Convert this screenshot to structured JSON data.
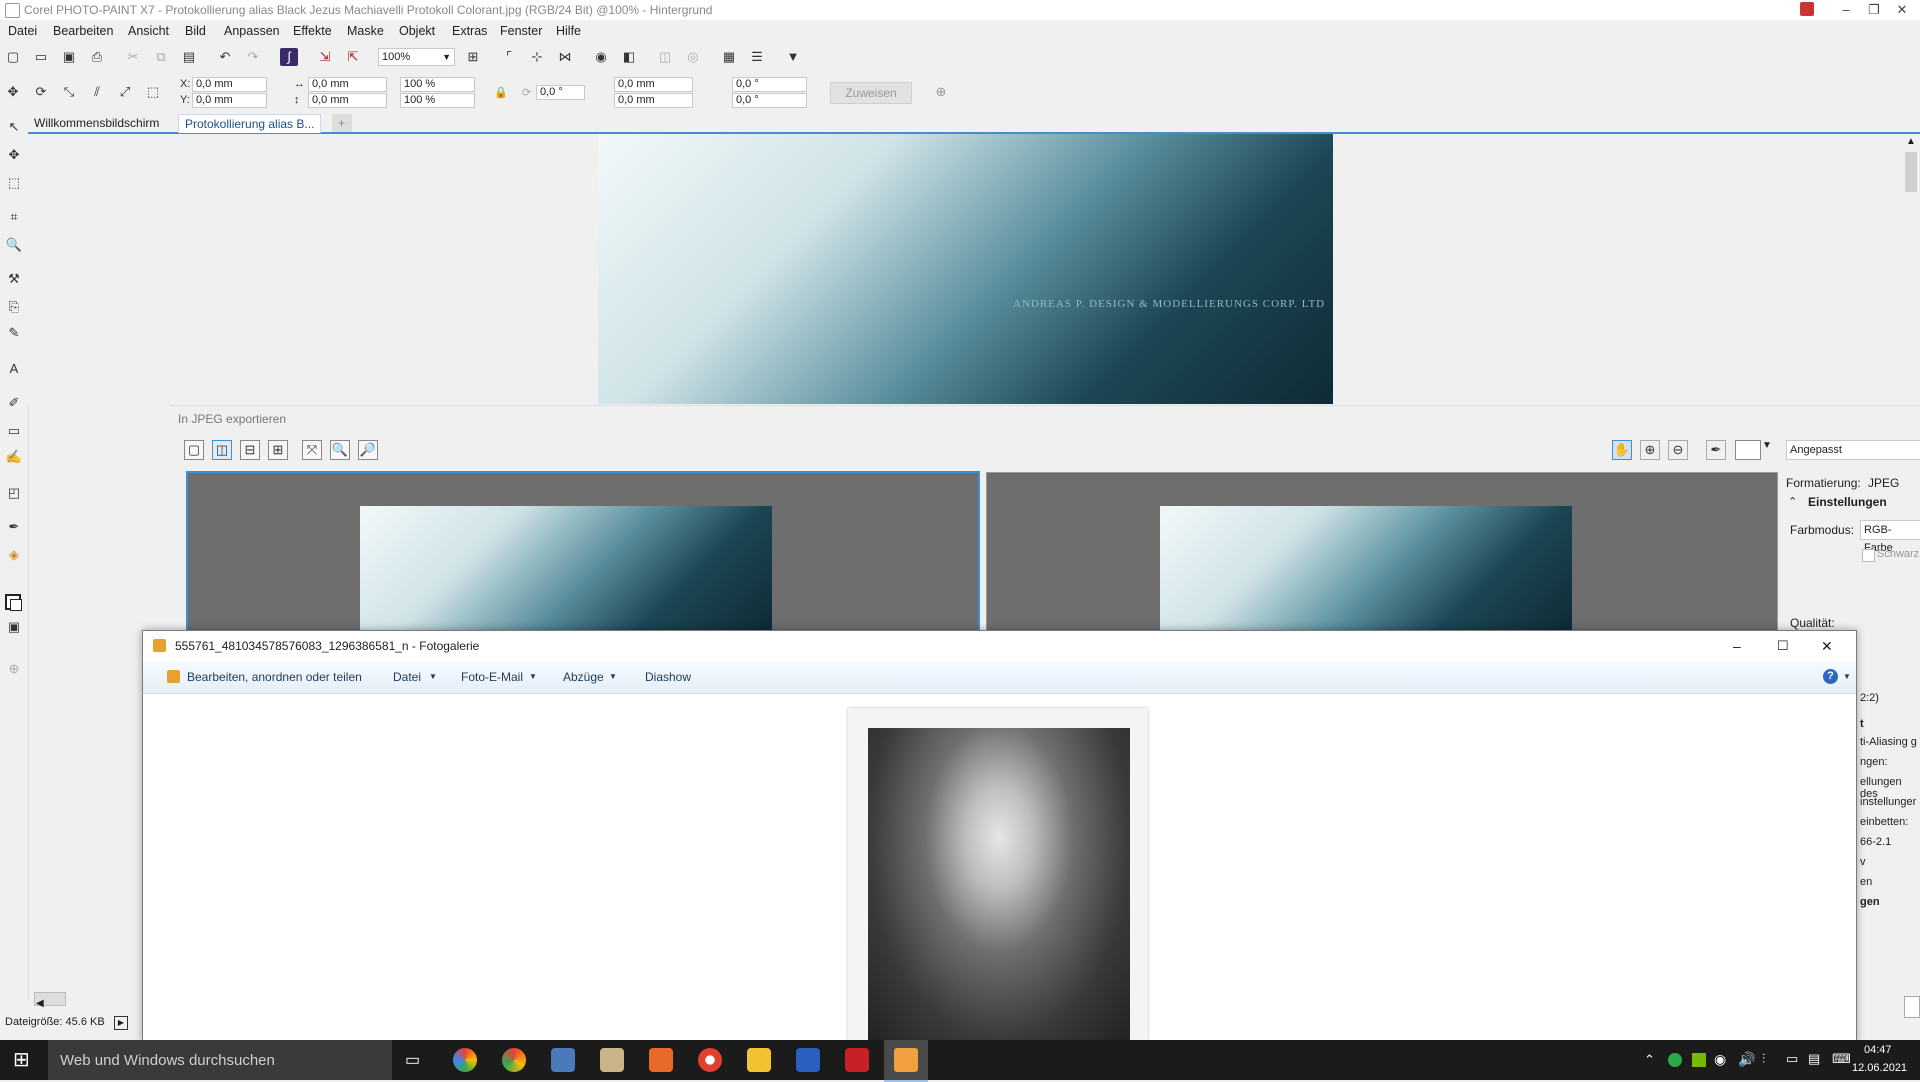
{
  "app": {
    "title": "Corel PHOTO-PAINT X7 - Protokollierung alias Black Jezus Machiavelli Protokoll Colorant.jpg (RGB/24 Bit) @100% - Hintergrund"
  },
  "menu": [
    "Datei",
    "Bearbeiten",
    "Ansicht",
    "Bild",
    "Anpassen",
    "Effekte",
    "Maske",
    "Objekt",
    "Extras",
    "Fenster",
    "Hilfe"
  ],
  "toolbar": {
    "zoom_value": "100%",
    "assign_button": "Zuweisen"
  },
  "property_bar": {
    "x_label": "X:",
    "x_value": "0,0 mm",
    "y_label": "Y:",
    "y_value": "0,0 mm",
    "w_value": "0,0 mm",
    "h_value": "0,0 mm",
    "scale_x": "100 %",
    "scale_y": "100 %",
    "rotation": "0,0 °",
    "center_x": "0,0 mm",
    "center_y": "0,0 mm",
    "skew_h": "0,0 °",
    "skew_v": "0,0 °"
  },
  "tabs": [
    {
      "label": "Willkommensbildschirm"
    },
    {
      "label": "Protokollierung alias B..."
    }
  ],
  "canvas_watermark": "ANDREAS P. DESIGN & MODELLIERUNGS CORP. LTD",
  "export_dialog": {
    "title": "In JPEG exportieren",
    "zoom_preset": "Angepasst",
    "format_label": "Formatierung:",
    "format_value": "JPEG",
    "settings_header": "Einstellungen",
    "color_mode_label": "Farbmodus:",
    "color_mode_value": "RGB-Farbe",
    "checkbox_label": "Schwarz",
    "quality_label": "Qualität:",
    "side_fragments": [
      "2:2)",
      "t",
      "ti-Aliasing g",
      "ngen:",
      "ellungen des",
      "instellunger",
      "einbetten:",
      "66-2.1",
      "v",
      "en",
      "gen"
    ]
  },
  "gallery": {
    "title": "555761_481034578576083_1296386581_n - Fotogalerie",
    "menu": [
      "Bearbeiten, anordnen oder teilen",
      "Datei",
      "Foto-E-Mail",
      "Abzüge",
      "Diashow"
    ]
  },
  "status": {
    "file_size": "Dateigröße: 45.6 KB"
  },
  "taskbar": {
    "search_placeholder": "Web und Windows durchsuchen",
    "time": "04:47",
    "date": "12.06.2021"
  },
  "colors": {
    "accent_blue": "#3c8fd8",
    "taskbar": "#1b1b1b"
  }
}
